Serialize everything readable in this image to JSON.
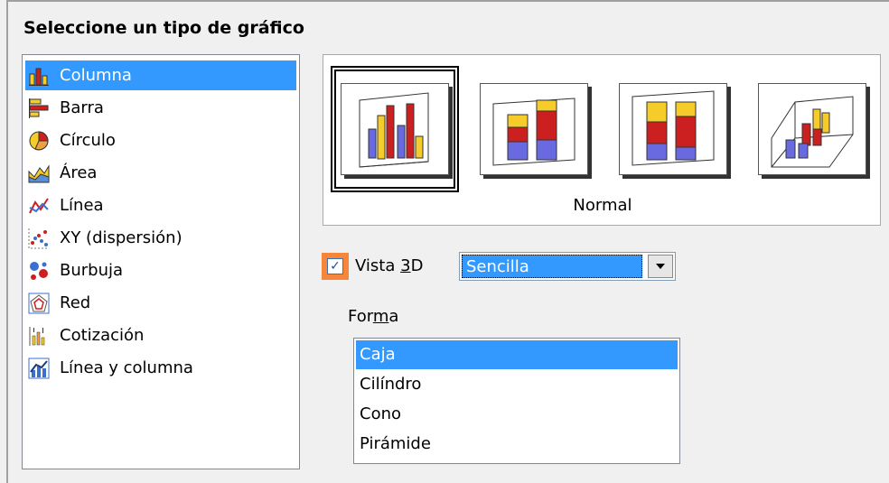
{
  "heading": "Seleccione un tipo de gráfico",
  "chart_types": [
    {
      "label": "Columna",
      "icon": "column-chart-icon",
      "selected": true
    },
    {
      "label": "Barra",
      "icon": "bar-chart-icon",
      "selected": false
    },
    {
      "label": "Círculo",
      "icon": "pie-chart-icon",
      "selected": false
    },
    {
      "label": "Área",
      "icon": "area-chart-icon",
      "selected": false
    },
    {
      "label": "Línea",
      "icon": "line-chart-icon",
      "selected": false
    },
    {
      "label": "XY (dispersión)",
      "icon": "scatter-chart-icon",
      "selected": false
    },
    {
      "label": "Burbuja",
      "icon": "bubble-chart-icon",
      "selected": false
    },
    {
      "label": "Red",
      "icon": "net-chart-icon",
      "selected": false
    },
    {
      "label": "Cotización",
      "icon": "stock-chart-icon",
      "selected": false
    },
    {
      "label": "Línea y columna",
      "icon": "line-column-chart-icon",
      "selected": false
    }
  ],
  "variant_label": "Normal",
  "variants": [
    {
      "name": "normal",
      "selected": true
    },
    {
      "name": "stacked",
      "selected": false
    },
    {
      "name": "percent-stacked",
      "selected": false
    },
    {
      "name": "deep",
      "selected": false
    }
  ],
  "view3d": {
    "label_pre": "Vista ",
    "label_mnemonic": "3",
    "label_post": "D",
    "checked": true,
    "checkmark": "✓"
  },
  "scheme": {
    "value": "Sencilla"
  },
  "shape": {
    "label_pre": "For",
    "label_mnemonic": "m",
    "label_post": "a",
    "options": [
      "Caja",
      "Cilíndro",
      "Cono",
      "Pirámide"
    ],
    "selected": "Caja"
  },
  "colors": {
    "selection": "#3399ff",
    "highlight": "#f7863a",
    "bar_red": "#cc1f1f",
    "bar_yellow": "#f5cc2a",
    "bar_blue": "#6a6ae0"
  }
}
